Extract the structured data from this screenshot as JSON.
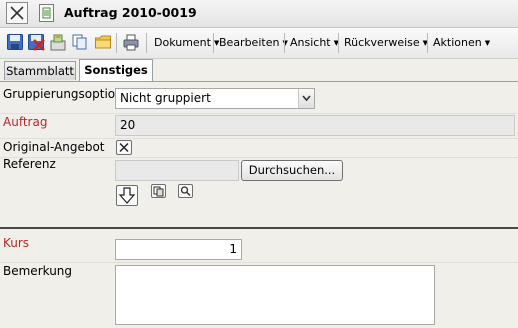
{
  "window": {
    "title": "Auftrag 2010-0019"
  },
  "toolbar": {
    "icons": [
      "save-icon",
      "delete-icon",
      "new-icon",
      "copy-icon",
      "folder-icon",
      "print-icon"
    ],
    "menus": [
      "Dokument",
      "Bearbeiten",
      "Ansicht",
      "Rückverweise",
      "Aktionen"
    ]
  },
  "tabs": [
    {
      "label": "Stammblatt",
      "active": false
    },
    {
      "label": "Sonstiges",
      "active": true
    }
  ],
  "form": {
    "grouping": {
      "label": "Gruppierungsoption",
      "value": "Nicht gruppiert"
    },
    "order": {
      "label": "Auftrag",
      "value": "20"
    },
    "original_offer": {
      "label": "Original-Angebot",
      "checked": true
    },
    "reference": {
      "label": "Referenz",
      "value": "",
      "browse_label": "Durchsuchen..."
    },
    "rate": {
      "label": "Kurs",
      "value": "1"
    },
    "remark": {
      "label": "Bemerkung",
      "value": ""
    }
  },
  "colors": {
    "required_label": "#b22a2a",
    "readonly_bg": "#e9e9e9"
  }
}
